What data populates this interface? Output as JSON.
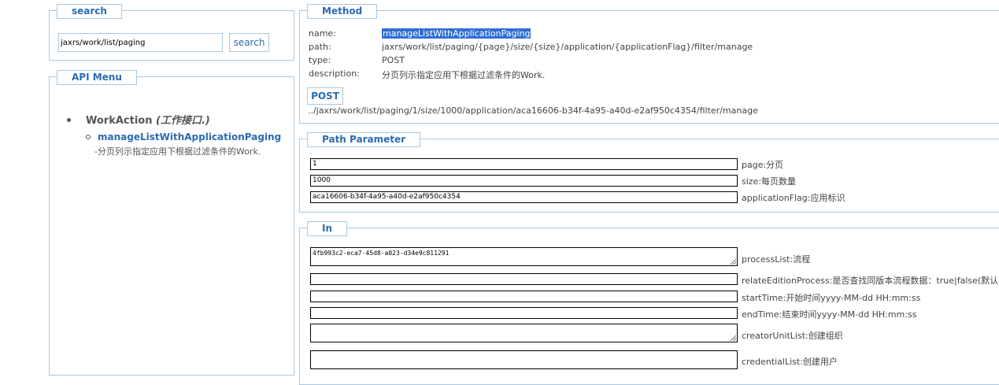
{
  "search": {
    "legend": "search",
    "input_value": "jaxrs/work/list/paging",
    "button_label": "search"
  },
  "api_menu": {
    "legend": "API Menu",
    "action_name": "WorkAction",
    "action_sub": " (工作接口.)",
    "item_link": "manageListWithApplicationPaging",
    "item_desc": "-分页列示指定应用下根据过滤条件的Work."
  },
  "method": {
    "legend": "Method",
    "name_label": "name:",
    "name_value": "manageListWithApplicationPaging",
    "path_label": "path:",
    "path_value": "jaxrs/work/list/paging/{page}/size/{size}/application/{applicationFlag}/filter/manage",
    "type_label": "type:",
    "type_value": "POST",
    "description_label": "description:",
    "description_value": "分页列示指定应用下根据过滤条件的Work.",
    "post_button": "POST",
    "url": "../jaxrs/work/list/paging/1/size/1000/application/aca16606-b34f-4a95-a40d-e2af950c4354/filter/manage"
  },
  "path_parameter": {
    "legend": "Path Parameter",
    "params": [
      {
        "value": "1",
        "label": "page:分页"
      },
      {
        "value": "1000",
        "label": "size:每页数量"
      },
      {
        "value": "aca16606-b34f-4a95-a40d-e2af950c4354",
        "label": "applicationFlag:应用标识"
      }
    ]
  },
  "in": {
    "legend": "In",
    "fields": [
      {
        "value": "4fb993c2-eca7-45d8-a023-d34e9c811291",
        "label": "processList:流程"
      },
      {
        "value": "",
        "label": "relateEditionProcess:是否查找同版本流程数据：true|false(默认不查"
      },
      {
        "value": "",
        "label": "startTime:开始时间yyyy-MM-dd HH:mm:ss"
      },
      {
        "value": "",
        "label": "endTime:结束时间yyyy-MM-dd HH:mm:ss"
      },
      {
        "value": "",
        "label": "creatorUnitList:创建组织"
      },
      {
        "value": "",
        "label": "credentialList:创建用户"
      }
    ]
  }
}
